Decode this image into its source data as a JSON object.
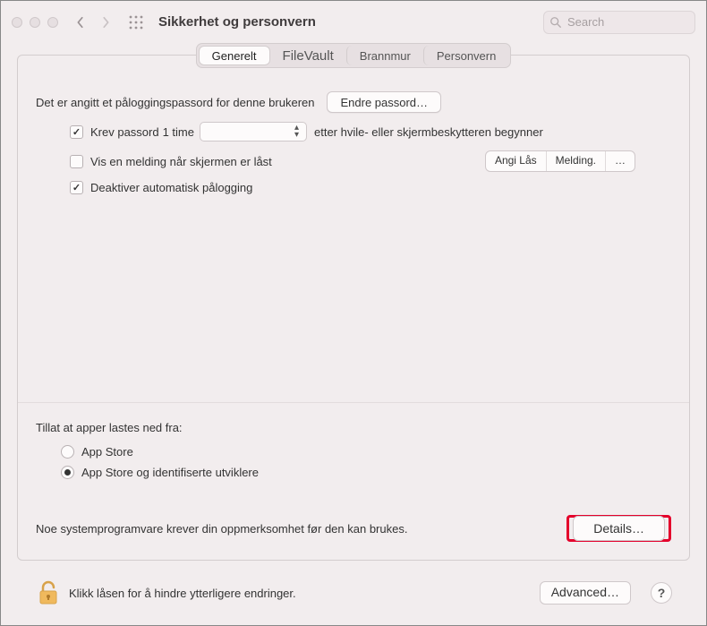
{
  "titlebar": {
    "title": "Sikkerhet og personvern",
    "search_placeholder": "Search"
  },
  "tabs": {
    "generelt": "Generelt",
    "filevault": "FileVault",
    "brannmur": "Brannmur",
    "personvern": "Personvern"
  },
  "login": {
    "password_set_text": "Det er angitt et påloggingspassord for denne brukeren",
    "change_password_btn": "Endre passord…",
    "require_pw_label": "Krev passord",
    "require_pw_delay": "1 time",
    "require_pw_after": "etter hvile- eller skjermbeskytteren begynner",
    "show_msg_label": "Vis en melding når skjermen er låst",
    "seg_set": "Angi Lås",
    "seg_msg": "Melding.",
    "seg_more": "…",
    "disable_autologin_label": "Deaktiver automatisk pålogging"
  },
  "download": {
    "heading": "Tillat at apper lastes ned fra:",
    "appstore": "App Store",
    "appstore_dev": "App Store og identifiserte utviklere"
  },
  "attention": {
    "text": "Noe systemprogramvare krever din oppmerksomhet før den kan brukes.",
    "details_btn": "Details…"
  },
  "footer": {
    "lock_text": "Klikk låsen for å hindre ytterligere endringer.",
    "advanced_btn": "Advanced…",
    "help": "?"
  }
}
